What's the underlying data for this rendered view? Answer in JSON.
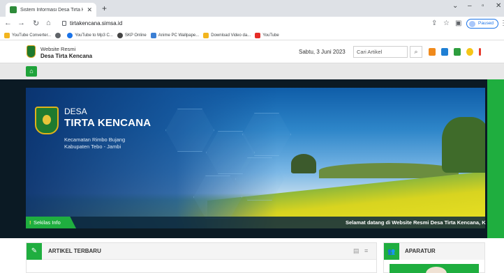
{
  "browser": {
    "tab_title": "Sistem Informasi Desa Tirta Kenc",
    "url": "tirtakencana.simsa.id",
    "paused_label": "Paused",
    "bookmarks": [
      {
        "label": "YouTube Converter...",
        "color": "#f2b51f"
      },
      {
        "label": "",
        "color": "#5f6368"
      },
      {
        "label": "YouTube to Mp3 C...",
        "color": "#1a73e8"
      },
      {
        "label": "SKP Online",
        "color": "#444444"
      },
      {
        "label": "Anime PC Wallpape...",
        "color": "#3b7fd4"
      },
      {
        "label": "Download Video da...",
        "color": "#f2b51f"
      },
      {
        "label": "YouTube",
        "color": "#e52d27"
      }
    ]
  },
  "site": {
    "name_line1": "Website Resmi",
    "name_line2": "Desa Tirta Kencana",
    "date": "Sabtu, 3 Juni 2023",
    "search_placeholder": "Cari Artikel",
    "header_icon_colors": [
      "#f08a1c",
      "#1f7fd4",
      "#2e9e3e",
      "#f5c518",
      "#e63b2e"
    ]
  },
  "hero": {
    "label": "DESA",
    "name": "TIRTA KENCANA",
    "kecamatan": "Kecamatan Rimbo Bujang",
    "kabupaten": "Kabupaten Tebo - Jambi",
    "ticker_label": "Sekilas Info",
    "ticker_text": "Selamat datang di Website Resmi Desa Tirta Kencana, K"
  },
  "panels": {
    "articles_title": "ARTIKEL TERBARU",
    "aparatur_title": "APARATUR"
  },
  "colors": {
    "brand_green": "#1fae3f",
    "hero_dark": "#0b1a24"
  }
}
